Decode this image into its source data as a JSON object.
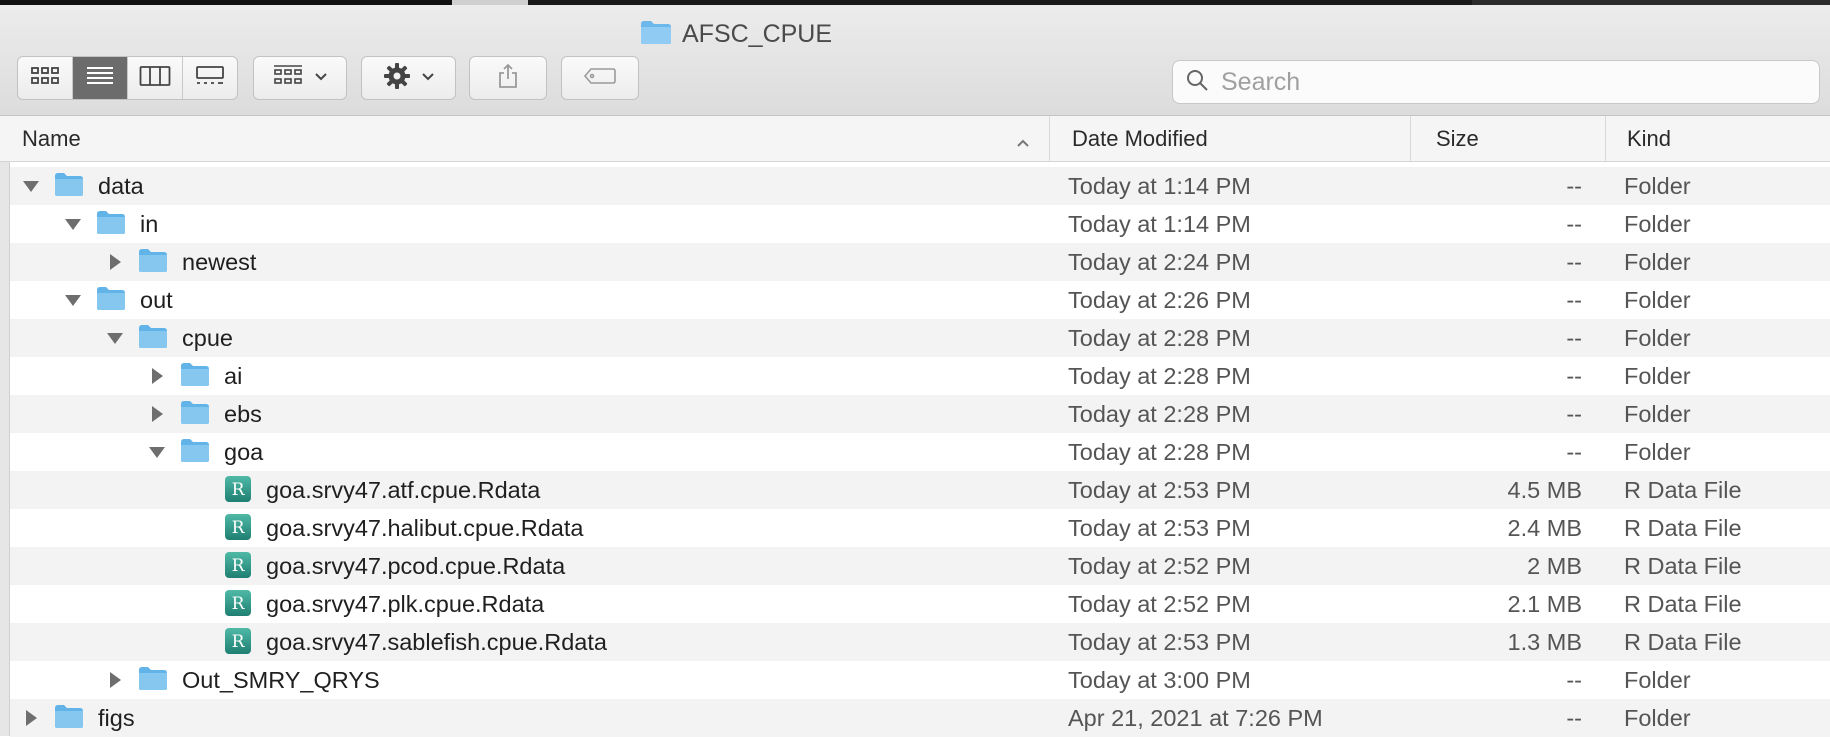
{
  "window": {
    "title": "AFSC_CPUE"
  },
  "search": {
    "placeholder": "Search"
  },
  "columns": {
    "name": "Name",
    "date": "Date Modified",
    "size": "Size",
    "kind": "Kind"
  },
  "colors": {
    "folder": "#7cc1ee",
    "rfile": "#2f9b8a",
    "selected_view": "#6c6c6c"
  },
  "rows": [
    {
      "name": "data",
      "date": "Today at 1:14 PM",
      "size": "--",
      "kind": "Folder",
      "level": 0,
      "type": "folder",
      "expanded": true
    },
    {
      "name": "in",
      "date": "Today at 1:14 PM",
      "size": "--",
      "kind": "Folder",
      "level": 1,
      "type": "folder",
      "expanded": true
    },
    {
      "name": "newest",
      "date": "Today at 2:24 PM",
      "size": "--",
      "kind": "Folder",
      "level": 2,
      "type": "folder",
      "expanded": false
    },
    {
      "name": "out",
      "date": "Today at 2:26 PM",
      "size": "--",
      "kind": "Folder",
      "level": 1,
      "type": "folder",
      "expanded": true
    },
    {
      "name": "cpue",
      "date": "Today at 2:28 PM",
      "size": "--",
      "kind": "Folder",
      "level": 2,
      "type": "folder",
      "expanded": true
    },
    {
      "name": "ai",
      "date": "Today at 2:28 PM",
      "size": "--",
      "kind": "Folder",
      "level": 3,
      "type": "folder",
      "expanded": false
    },
    {
      "name": "ebs",
      "date": "Today at 2:28 PM",
      "size": "--",
      "kind": "Folder",
      "level": 3,
      "type": "folder",
      "expanded": false
    },
    {
      "name": "goa",
      "date": "Today at 2:28 PM",
      "size": "--",
      "kind": "Folder",
      "level": 3,
      "type": "folder",
      "expanded": true
    },
    {
      "name": "goa.srvy47.atf.cpue.Rdata",
      "date": "Today at 2:53 PM",
      "size": "4.5 MB",
      "kind": "R Data File",
      "level": 4,
      "type": "rfile"
    },
    {
      "name": "goa.srvy47.halibut.cpue.Rdata",
      "date": "Today at 2:53 PM",
      "size": "2.4 MB",
      "kind": "R Data File",
      "level": 4,
      "type": "rfile"
    },
    {
      "name": "goa.srvy47.pcod.cpue.Rdata",
      "date": "Today at 2:52 PM",
      "size": "2 MB",
      "kind": "R Data File",
      "level": 4,
      "type": "rfile"
    },
    {
      "name": "goa.srvy47.plk.cpue.Rdata",
      "date": "Today at 2:52 PM",
      "size": "2.1 MB",
      "kind": "R Data File",
      "level": 4,
      "type": "rfile"
    },
    {
      "name": "goa.srvy47.sablefish.cpue.Rdata",
      "date": "Today at 2:53 PM",
      "size": "1.3 MB",
      "kind": "R Data File",
      "level": 4,
      "type": "rfile"
    },
    {
      "name": "Out_SMRY_QRYS",
      "date": "Today at 3:00 PM",
      "size": "--",
      "kind": "Folder",
      "level": 2,
      "type": "folder",
      "expanded": false
    },
    {
      "name": "figs",
      "date": "Apr 21, 2021 at 7:26 PM",
      "size": "--",
      "kind": "Folder",
      "level": 0,
      "type": "folder",
      "expanded": false
    }
  ]
}
